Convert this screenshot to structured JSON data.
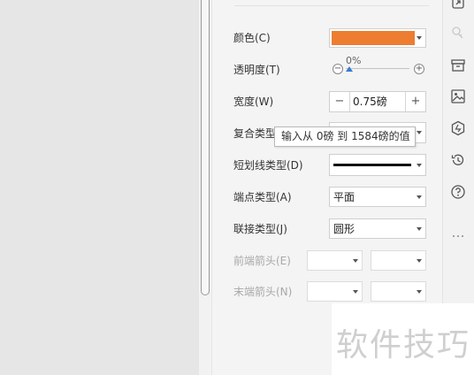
{
  "form": {
    "color": {
      "label": "颜色(C)",
      "swatch": "#ed7d31"
    },
    "transparency": {
      "label": "透明度(T)",
      "value": "0%",
      "level": 0
    },
    "width": {
      "label": "宽度(W)",
      "value": "0.75磅",
      "minus": "−",
      "plus": "+"
    },
    "compound": {
      "label": "复合类型"
    },
    "dash": {
      "label": "短划线类型(D)"
    },
    "cap": {
      "label": "端点类型(A)",
      "value": "平面"
    },
    "join": {
      "label": "联接类型(J)",
      "value": "圆形"
    },
    "begin_arrow": {
      "label": "前端箭头(E)"
    },
    "end_arrow": {
      "label": "末端箭头(N)"
    }
  },
  "tooltip": "输入从 0磅 到 1584磅的值",
  "watermark": "软件技巧",
  "rail_icons": [
    "share-icon",
    "pin-icon",
    "archive-icon",
    "image-icon",
    "hexagon-icon",
    "history-icon",
    "help-icon",
    "more-icon"
  ],
  "accent": "#ed7d31"
}
